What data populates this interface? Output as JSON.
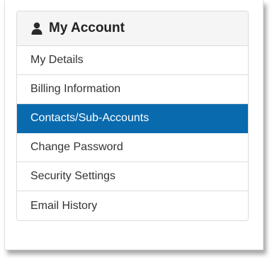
{
  "panel": {
    "title": "My Account",
    "icon": "user-icon"
  },
  "menu": {
    "items": [
      {
        "label": "My Details",
        "active": false
      },
      {
        "label": "Billing Information",
        "active": false
      },
      {
        "label": "Contacts/Sub-Accounts",
        "active": true
      },
      {
        "label": "Change Password",
        "active": false
      },
      {
        "label": "Security Settings",
        "active": false
      },
      {
        "label": "Email History",
        "active": false
      }
    ]
  },
  "colors": {
    "active_bg": "#0a6aae",
    "header_bg": "#f5f5f5"
  }
}
